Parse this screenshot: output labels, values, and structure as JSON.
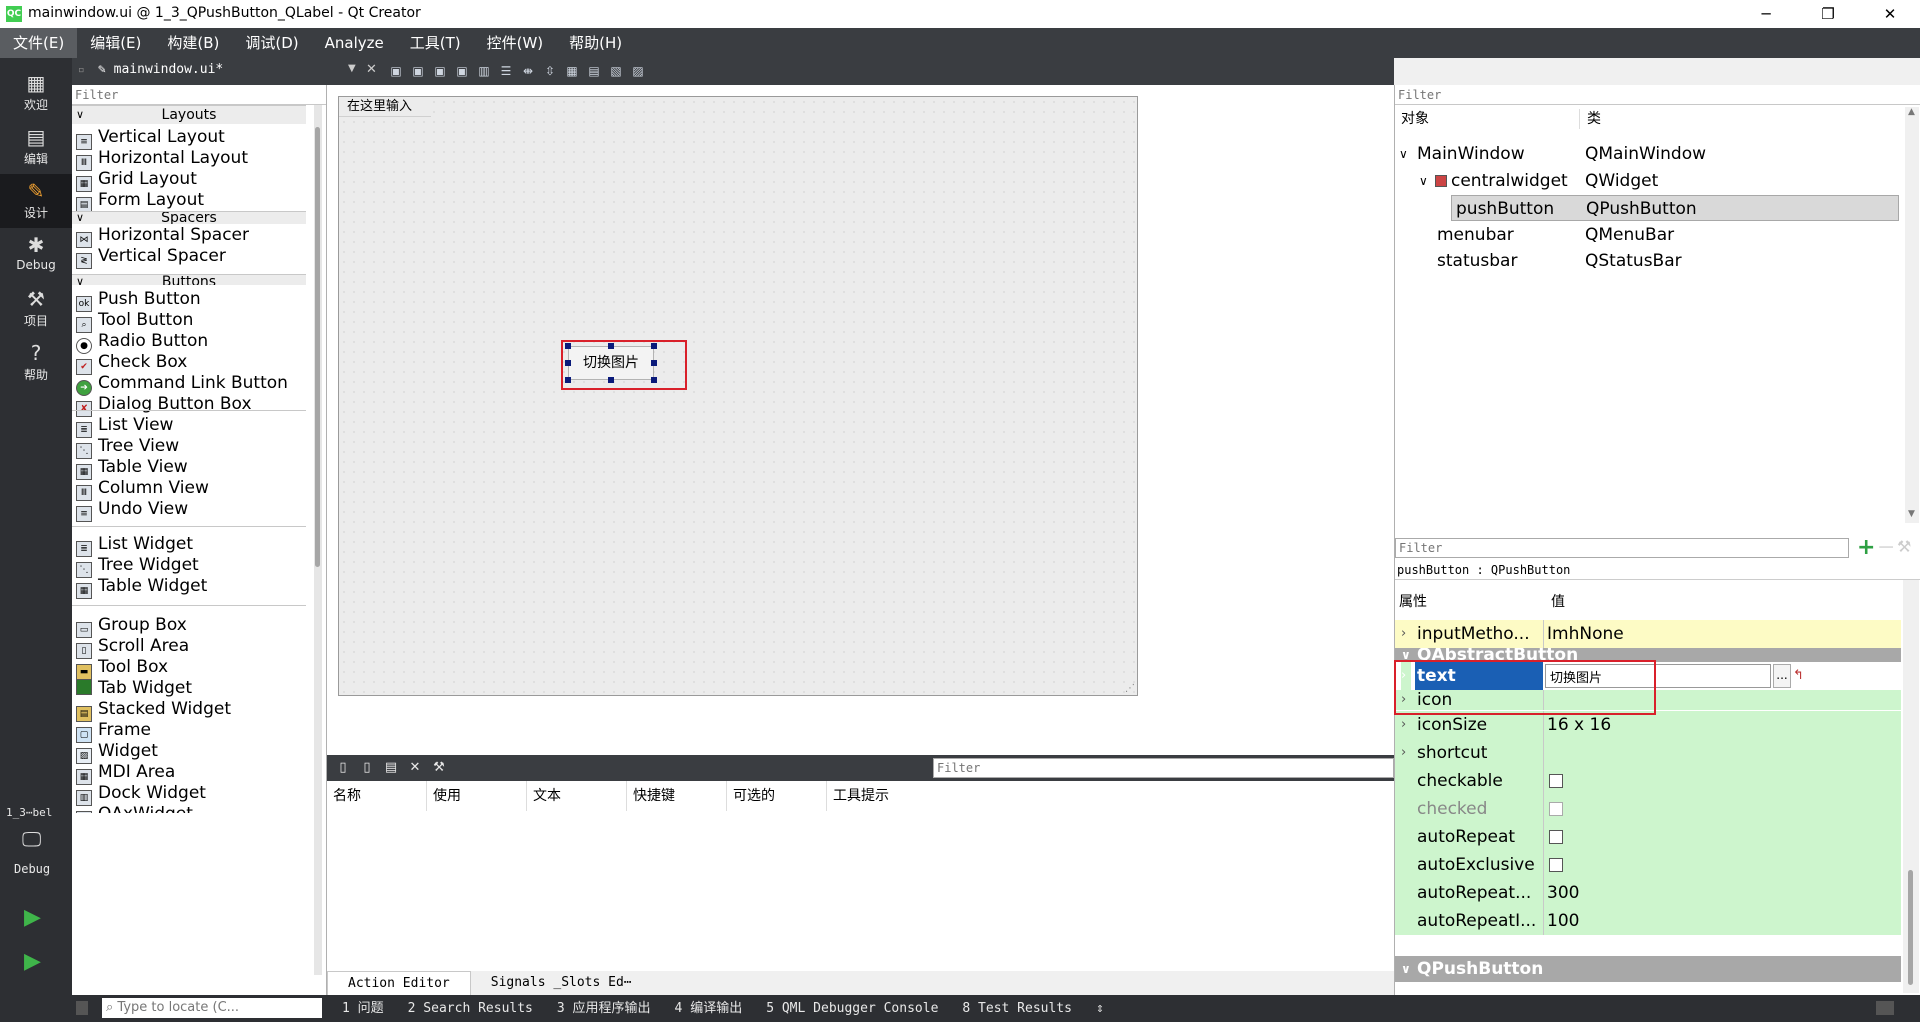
{
  "window": {
    "title": "mainwindow.ui @ 1_3_QPushButton_QLabel - Qt Creator",
    "min": "─",
    "max": "❐",
    "close": "✕"
  },
  "menu": [
    "文件(E)",
    "编辑(E)",
    "构建(B)",
    "调试(D)",
    "Analyze",
    "工具(T)",
    "控件(W)",
    "帮助(H)"
  ],
  "modes": [
    {
      "label": "欢迎",
      "icon": "grid-icon"
    },
    {
      "label": "编辑",
      "icon": "document-icon"
    },
    {
      "label": "设计",
      "icon": "pencil-icon"
    },
    {
      "label": "Debug",
      "icon": "bug-icon"
    },
    {
      "label": "项目",
      "icon": "wrench-icon"
    },
    {
      "label": "帮助",
      "icon": "help-icon"
    }
  ],
  "kit": {
    "project": "1_3⋯bel",
    "config": "Debug"
  },
  "editor": {
    "doc_tab": "mainwindow.ui*"
  },
  "widgetbox": {
    "filter_placeholder": "Filter",
    "categories": {
      "layouts": "Layouts",
      "spacers": "Spacers",
      "buttons": "Buttons"
    },
    "layouts": [
      "Vertical Layout",
      "Horizontal Layout",
      "Grid Layout",
      "Form Layout"
    ],
    "spacers": [
      "Horizontal Spacer",
      "Vertical Spacer"
    ],
    "buttons": [
      "Push Button",
      "Tool Button",
      "Radio Button",
      "Check Box",
      "Command Link Button",
      "Dialog Button Box"
    ],
    "item_views": [
      "List View",
      "Tree View",
      "Table View",
      "Column View",
      "Undo View"
    ],
    "item_widgets": [
      "List Widget",
      "Tree Widget",
      "Table Widget"
    ],
    "containers": [
      "Group Box",
      "Scroll Area",
      "Tool Box",
      "Tab Widget",
      "Stacked Widget",
      "Frame",
      "Widget",
      "MDI Area",
      "Dock Widget",
      "QAxWidget"
    ]
  },
  "form": {
    "menu_hint": "在这里输入",
    "push_button_text": "切换图片"
  },
  "action_editor": {
    "filter_placeholder": "Filter",
    "columns": [
      "名称",
      "使用",
      "文本",
      "快捷键",
      "可选的",
      "工具提示"
    ],
    "tabs": [
      "Action Editor",
      "Signals _Slots Ed⋯"
    ]
  },
  "object_inspector": {
    "filter_placeholder": "Filter",
    "col_object": "对象",
    "col_class": "类",
    "rows": [
      {
        "name": "MainWindow",
        "cls": "QMainWindow"
      },
      {
        "name": "centralwidget",
        "cls": "QWidget"
      },
      {
        "name": "pushButton",
        "cls": "QPushButton"
      },
      {
        "name": "menubar",
        "cls": "QMenuBar"
      },
      {
        "name": "statusbar",
        "cls": "QStatusBar"
      }
    ]
  },
  "property_editor": {
    "filter_placeholder": "Filter",
    "object_label": "pushButton : QPushButton",
    "col_property": "属性",
    "col_value": "值",
    "input_method": {
      "name": "inputMetho...",
      "value": "ImhNone"
    },
    "section_abstract": "QAbstractButton",
    "text_row": {
      "name": "text",
      "value": "切换图片"
    },
    "browse": "...",
    "rows": [
      {
        "name": "icon",
        "value": ""
      },
      {
        "name": "iconSize",
        "value": "16 x 16"
      },
      {
        "name": "shortcut",
        "value": ""
      },
      {
        "name": "checkable",
        "value": ""
      },
      {
        "name": "checked",
        "value": ""
      },
      {
        "name": "autoRepeat",
        "value": ""
      },
      {
        "name": "autoExclusive",
        "value": ""
      },
      {
        "name": "autoRepeat...",
        "value": "300"
      },
      {
        "name": "autoRepeatI...",
        "value": "100"
      }
    ],
    "section_push": "QPushButton"
  },
  "statusbar": {
    "locate_placeholder": "Type to locate (C...",
    "tabs": [
      "1 问题",
      "2 Search Results",
      "3 应用程序输出",
      "4 编译输出",
      "5 QML Debugger Console",
      "8 Test Results"
    ]
  }
}
